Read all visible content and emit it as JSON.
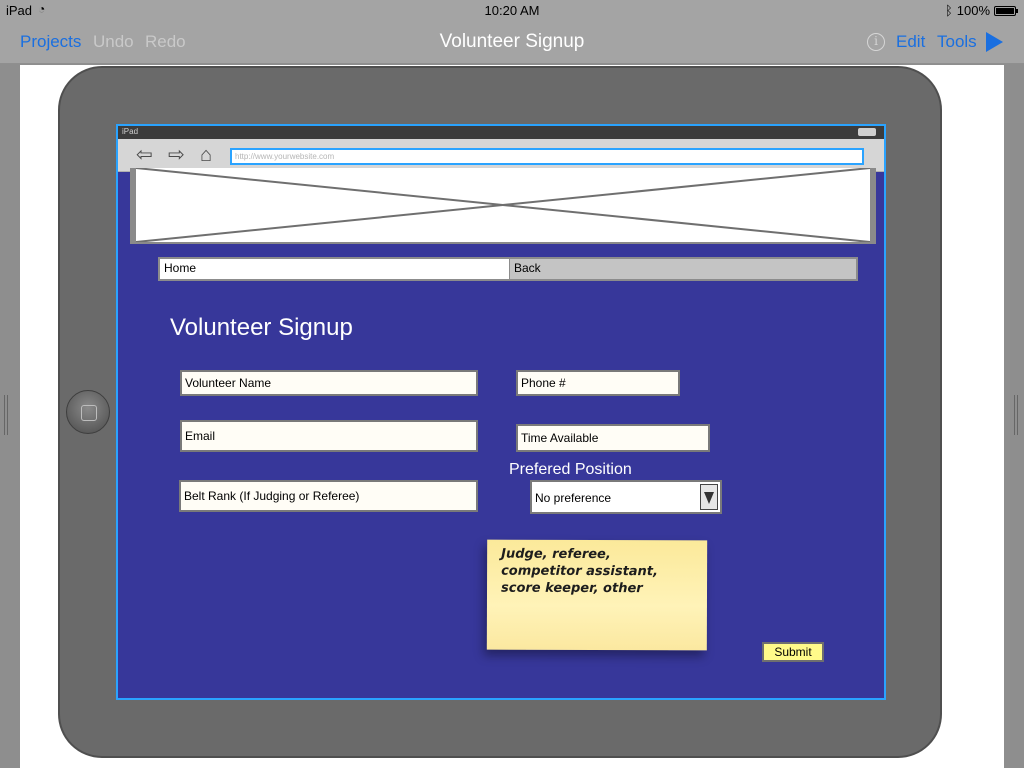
{
  "status": {
    "device": "iPad",
    "time": "10:20 AM",
    "battery": "100%"
  },
  "toolbar": {
    "projects": "Projects",
    "undo": "Undo",
    "redo": "Redo",
    "title": "Volunteer Signup",
    "info": "i",
    "edit": "Edit",
    "tools": "Tools"
  },
  "device_screen": {
    "status_label": "iPad",
    "url_placeholder": "http://www.yourwebsite.com",
    "nav": {
      "home": "Home",
      "back": "Back"
    },
    "form": {
      "title": "Volunteer Signup",
      "volunteer_name": "Volunteer Name",
      "phone": "Phone #",
      "email": "Email",
      "time_available": "Time Available",
      "preferred_position_label": "Prefered Position",
      "preferred_position_value": "No preference",
      "belt_rank": "Belt Rank (If Judging or Referee)",
      "submit": "Submit"
    },
    "sticky_note": "Judge, referee, competitor assistant, score keeper, other"
  },
  "colors": {
    "accent": "#1a6fe0",
    "screen_bg": "#37379a",
    "screen_border": "#2aa3ff",
    "sticky": "#fff3b8"
  }
}
